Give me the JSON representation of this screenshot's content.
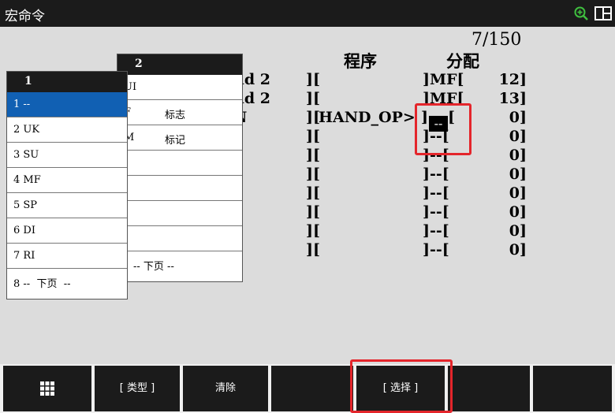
{
  "window": {
    "title": "宏命令"
  },
  "header": {
    "page_indicator": "7/150",
    "col_program": "程序",
    "col_assign": "分配"
  },
  "rows": [
    {
      "name": "nd 2",
      "b1": "][",
      "prog": "",
      "b2": "]MF[",
      "num": "12]"
    },
    {
      "name": "nd 2",
      "b1": "][",
      "prog": "",
      "b2": "]MF[",
      "num": "13]"
    },
    {
      "name": "N",
      "b1": "][",
      "prog": "HAND_OP>",
      "b2": "]",
      "cursor": "--",
      "b3": "[",
      "num": "0]"
    },
    {
      "name": "",
      "b1": "][",
      "prog": "",
      "b2": "]--[",
      "num": "0]"
    },
    {
      "name": "",
      "b1": "][",
      "prog": "",
      "b2": "]--[",
      "num": "0]"
    },
    {
      "name": "",
      "b1": "][",
      "prog": "",
      "b2": "]--[",
      "num": "0]"
    },
    {
      "name": "",
      "b1": "][",
      "prog": "",
      "b2": "]--[",
      "num": "0]"
    },
    {
      "name": "",
      "b1": "][",
      "prog": "",
      "b2": "]--[",
      "num": "0]"
    },
    {
      "name": "",
      "b1": "][",
      "prog": "",
      "b2": "]--[",
      "num": "0]"
    },
    {
      "name": "",
      "b1": "][",
      "prog": "",
      "b2": "]--[",
      "num": "0]"
    }
  ],
  "popup1": {
    "header": "1",
    "items": [
      "1 --",
      "2 UK",
      "3 SU",
      "4 MF",
      "5 SP",
      "6 DI",
      "7 RI",
      "8 --  下页  --"
    ]
  },
  "popup2": {
    "header": "2",
    "items": [
      {
        "k": "UI",
        "v": ""
      },
      {
        "k": "F",
        "v": "标志"
      },
      {
        "k": "M",
        "v": "标记"
      },
      {
        "k": "",
        "v": ""
      },
      {
        "k": "",
        "v": ""
      },
      {
        "k": "",
        "v": ""
      },
      {
        "k": "",
        "v": ""
      },
      {
        "k": "--  下页  --",
        "v": ""
      }
    ]
  },
  "fkeys": {
    "f1_icon": "grid-icon",
    "f2": "[ 类型 ]",
    "f3": "清除",
    "f4": "",
    "f5": "[ 选择 ]",
    "f6": "",
    "f7": ""
  },
  "colors": {
    "selection": "#1160b3",
    "highlight": "#e4252b",
    "bar": "#1b1b1b",
    "screen": "#dcdcdc"
  }
}
